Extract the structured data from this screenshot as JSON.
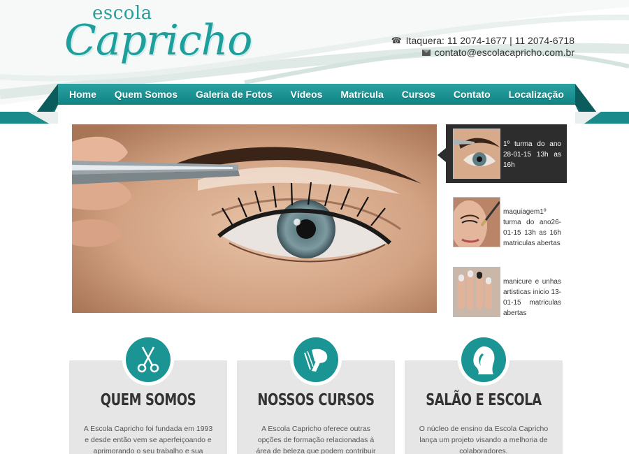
{
  "logo": {
    "small": "escola",
    "big": "Capricho"
  },
  "contact": {
    "phone_icon": "phone-icon",
    "phone": "Itaquera: 11 2074-1677 | 11 2074-6718",
    "email_icon": "mail-icon",
    "email": "contato@escolacapricho.com.br"
  },
  "nav": [
    "Home",
    "Quem Somos",
    "Galeria de Fotos",
    "Vídeos",
    "Matrícula",
    "Cursos",
    "Contato",
    "Localização"
  ],
  "news": [
    {
      "text": "1º turma do ano 28-01-15 13h as 16h"
    },
    {
      "text": "maquiagem1º turma do ano26-01-15 13h as 16h matriculas abertas"
    },
    {
      "text": "manicure e unhas artisticas inicio 13-01-15 matriculas abertas"
    }
  ],
  "features": [
    {
      "icon": "scissors-icon",
      "title": "QUEM SOMOS",
      "text": "A Escola Capricho foi fundada em 1993 e desde então vem se aperfeiçoando e aprimorando o seu trabalho e sua equipe."
    },
    {
      "icon": "hair-dryer-icon",
      "title": "NOSSOS CURSOS",
      "text": "A Escola Capricho oferece outras opções de formação relacionadas à área de beleza que podem contribuir para ampliar mais."
    },
    {
      "icon": "woman-profile-icon",
      "title": "SALÃO E ESCOLA",
      "text": "O núcleo de ensino da Escola Capricho lança um projeto visando a melhoria de colaboradores."
    }
  ],
  "colors": {
    "teal": "#1b9593",
    "dark": "#2d2d2d",
    "feature_bg": "#e6e6e6"
  }
}
